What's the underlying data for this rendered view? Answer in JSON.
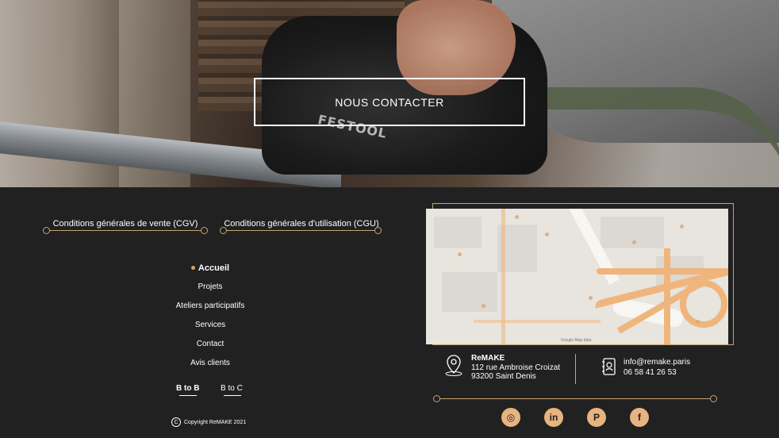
{
  "hero": {
    "contact_button": "NOUS CONTACTER",
    "tool_brand": "FESTOOL"
  },
  "legal": {
    "cgv": "Conditions générales de vente (CGV)",
    "cgu": "Conditions générales d'utilisation (CGU)"
  },
  "nav": {
    "items": [
      {
        "label": "Accueil",
        "active": true
      },
      {
        "label": "Projets"
      },
      {
        "label": "Ateliers participatifs"
      },
      {
        "label": "Services"
      },
      {
        "label": "Contact"
      },
      {
        "label": "Avis clients"
      }
    ]
  },
  "audience": {
    "btob": "B to B",
    "btoc": "B to C"
  },
  "copyright": "Copyright ReMAKE 2021",
  "map": {
    "credit": "Google  Map data"
  },
  "address": {
    "name": "ReMAKE",
    "street": "112 rue Ambroise Croizat",
    "city": "93200 Saint Denis",
    "icon": "location-pin-icon"
  },
  "contact": {
    "email": "info@remake.paris",
    "phone": "06 58 41 26 53",
    "icon": "address-book-icon"
  },
  "socials": [
    {
      "name": "instagram-icon",
      "glyph": "◎"
    },
    {
      "name": "linkedin-icon",
      "glyph": "in"
    },
    {
      "name": "pinterest-icon",
      "glyph": "P"
    },
    {
      "name": "facebook-icon",
      "glyph": "f"
    }
  ],
  "colors": {
    "accent": "#c8a272",
    "social_bg": "#e7b37f",
    "footer_bg": "#212121",
    "active_dot": "#e2a15a"
  }
}
